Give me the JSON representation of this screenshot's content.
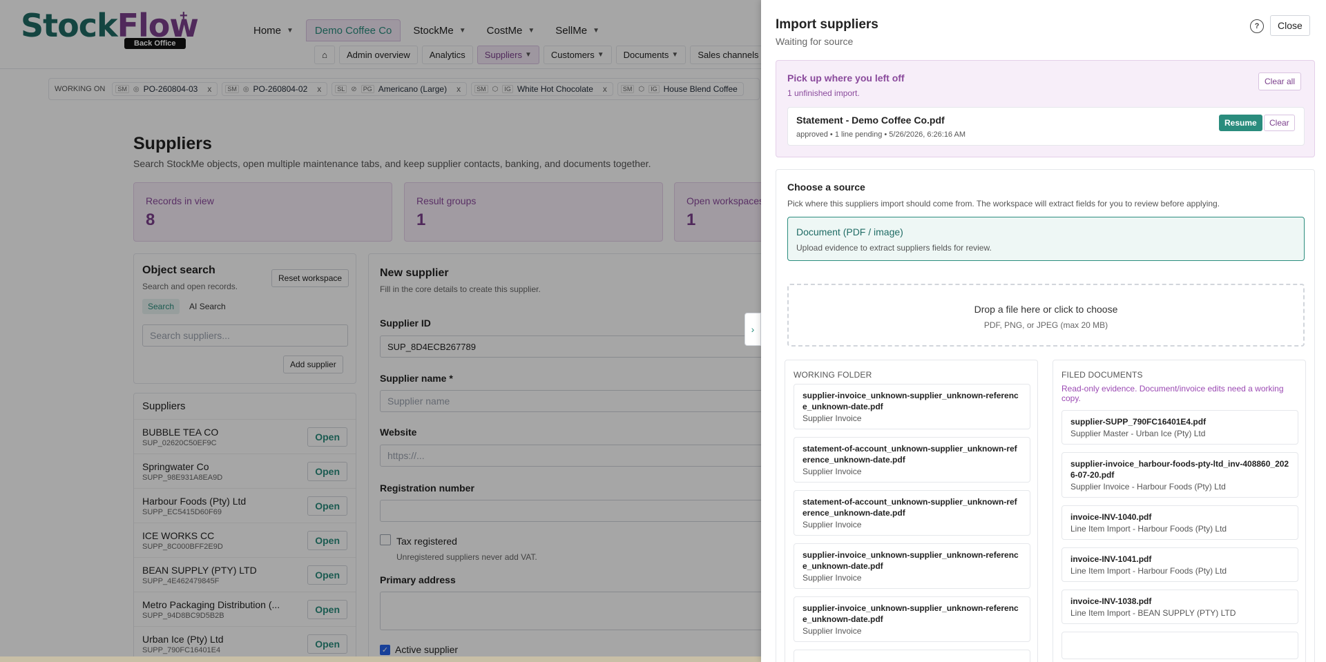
{
  "app": {
    "logo_main_1": "Stock",
    "logo_main_2": "Flow",
    "logo_plus": "+",
    "logo_badge": "Back Office"
  },
  "topnav": [
    {
      "label": "Home"
    },
    {
      "label": "Demo Coffee Co"
    },
    {
      "label": "StockMe"
    },
    {
      "label": "CostMe"
    },
    {
      "label": "SellMe"
    }
  ],
  "subnav": [
    {
      "label": "Admin overview"
    },
    {
      "label": "Analytics"
    },
    {
      "label": "Suppliers"
    },
    {
      "label": "Customers"
    },
    {
      "label": "Documents"
    },
    {
      "label": "Sales channels"
    }
  ],
  "working": {
    "label": "WORKING ON",
    "chips": [
      {
        "tag1": "SM",
        "label": "PO-260804-03"
      },
      {
        "tag1": "SM",
        "label": "PO-260804-02"
      },
      {
        "tag1": "SL",
        "tag2": "PG",
        "label": "Americano (Large)"
      },
      {
        "tag1": "SM",
        "tag2": "IG",
        "label": "White Hot Chocolate"
      },
      {
        "tag1": "SM",
        "tag2": "IG",
        "label": "House Blend Coffee"
      }
    ],
    "close": "x"
  },
  "page": {
    "title": "Suppliers",
    "description": "Search StockMe objects, open multiple maintenance tabs, and keep supplier contacts, banking, and documents together."
  },
  "stats": [
    {
      "label": "Records in view",
      "value": "8"
    },
    {
      "label": "Result groups",
      "value": "1"
    },
    {
      "label": "Open workspaces",
      "value": "1"
    }
  ],
  "object_search": {
    "title": "Object search",
    "subtitle": "Search and open records.",
    "reset": "Reset workspace",
    "tab_search": "Search",
    "tab_ai": "AI Search",
    "placeholder": "Search suppliers...",
    "add": "Add supplier"
  },
  "suppliers": {
    "title": "Suppliers",
    "open_label": "Open",
    "items": [
      {
        "name": "BUBBLE TEA CO",
        "id": "SUP_02620C50EF9C"
      },
      {
        "name": "Springwater Co",
        "id": "SUPP_98E931A8EA9D"
      },
      {
        "name": "Harbour Foods (Pty) Ltd",
        "id": "SUPP_EC5415D60F69"
      },
      {
        "name": "ICE WORKS CC",
        "id": "SUPP_8C000BFF2E9D"
      },
      {
        "name": "BEAN SUPPLY (PTY) LTD",
        "id": "SUPP_4E462479845F"
      },
      {
        "name": "Metro Packaging Distribution (...",
        "id": "SUPP_94D8BC9D5B2B"
      },
      {
        "name": "Urban Ice (Pty) Ltd",
        "id": "SUPP_790FC16401E4"
      }
    ]
  },
  "new_supplier": {
    "title": "New supplier",
    "subtitle": "Fill in the core details to create this supplier.",
    "id_label": "Supplier ID",
    "id_value": "SUP_8D4ECB267789",
    "name_label": "Supplier name *",
    "name_placeholder": "Supplier name",
    "website_label": "Website",
    "website_placeholder": "https://...",
    "reg_label": "Registration number",
    "tax_label": "Tax registered",
    "tax_help": "Unregistered suppliers never add VAT.",
    "address_label": "Primary address",
    "active_label": "Active supplier"
  },
  "drawer": {
    "title": "Import suppliers",
    "subtitle": "Waiting for source",
    "help": "?",
    "close": "Close",
    "collapse": "›",
    "resume": {
      "title": "Pick up where you left off",
      "subtitle": "1 unfinished import.",
      "clear_all": "Clear all",
      "file": "Statement - Demo Coffee Co.pdf",
      "meta": "approved • 1 line pending • 5/26/2026, 6:26:16 AM",
      "resume_label": "Resume",
      "clear_label": "Clear"
    },
    "source": {
      "title": "Choose a source",
      "subtitle": "Pick where this suppliers import should come from. The workspace will extract fields for you to review before applying.",
      "option_title": "Document (PDF / image)",
      "option_sub": "Upload evidence to extract suppliers fields for review.",
      "drop_title": "Drop a file here or click to choose",
      "drop_sub": "PDF, PNG, or JPEG (max 20 MB)"
    },
    "working_folder": {
      "title": "WORKING FOLDER",
      "docs": [
        {
          "name": "supplier-invoice_unknown-supplier_unknown-reference_unknown-date.pdf",
          "type": "Supplier Invoice"
        },
        {
          "name": "statement-of-account_unknown-supplier_unknown-reference_unknown-date.pdf",
          "type": "Supplier Invoice"
        },
        {
          "name": "statement-of-account_unknown-supplier_unknown-reference_unknown-date.pdf",
          "type": "Supplier Invoice"
        },
        {
          "name": "supplier-invoice_unknown-supplier_unknown-reference_unknown-date.pdf",
          "type": "Supplier Invoice"
        },
        {
          "name": "supplier-invoice_unknown-supplier_unknown-reference_unknown-date.pdf",
          "type": "Supplier Invoice"
        }
      ]
    },
    "filed_documents": {
      "title": "FILED DOCUMENTS",
      "note": "Read-only evidence. Document/invoice edits need a working copy.",
      "docs": [
        {
          "name": "supplier-SUPP_790FC16401E4.pdf",
          "type": "Supplier Master - Urban Ice (Pty) Ltd"
        },
        {
          "name": "supplier-invoice_harbour-foods-pty-ltd_inv-408860_2026-07-20.pdf",
          "type": "Supplier Invoice - Harbour Foods (Pty) Ltd"
        },
        {
          "name": "invoice-INV-1040.pdf",
          "type": "Line Item Import - Harbour Foods (Pty) Ltd"
        },
        {
          "name": "invoice-INV-1041.pdf",
          "type": "Line Item Import - Harbour Foods (Pty) Ltd"
        },
        {
          "name": "invoice-INV-1038.pdf",
          "type": "Line Item Import - BEAN SUPPLY (PTY) LTD"
        }
      ]
    }
  }
}
